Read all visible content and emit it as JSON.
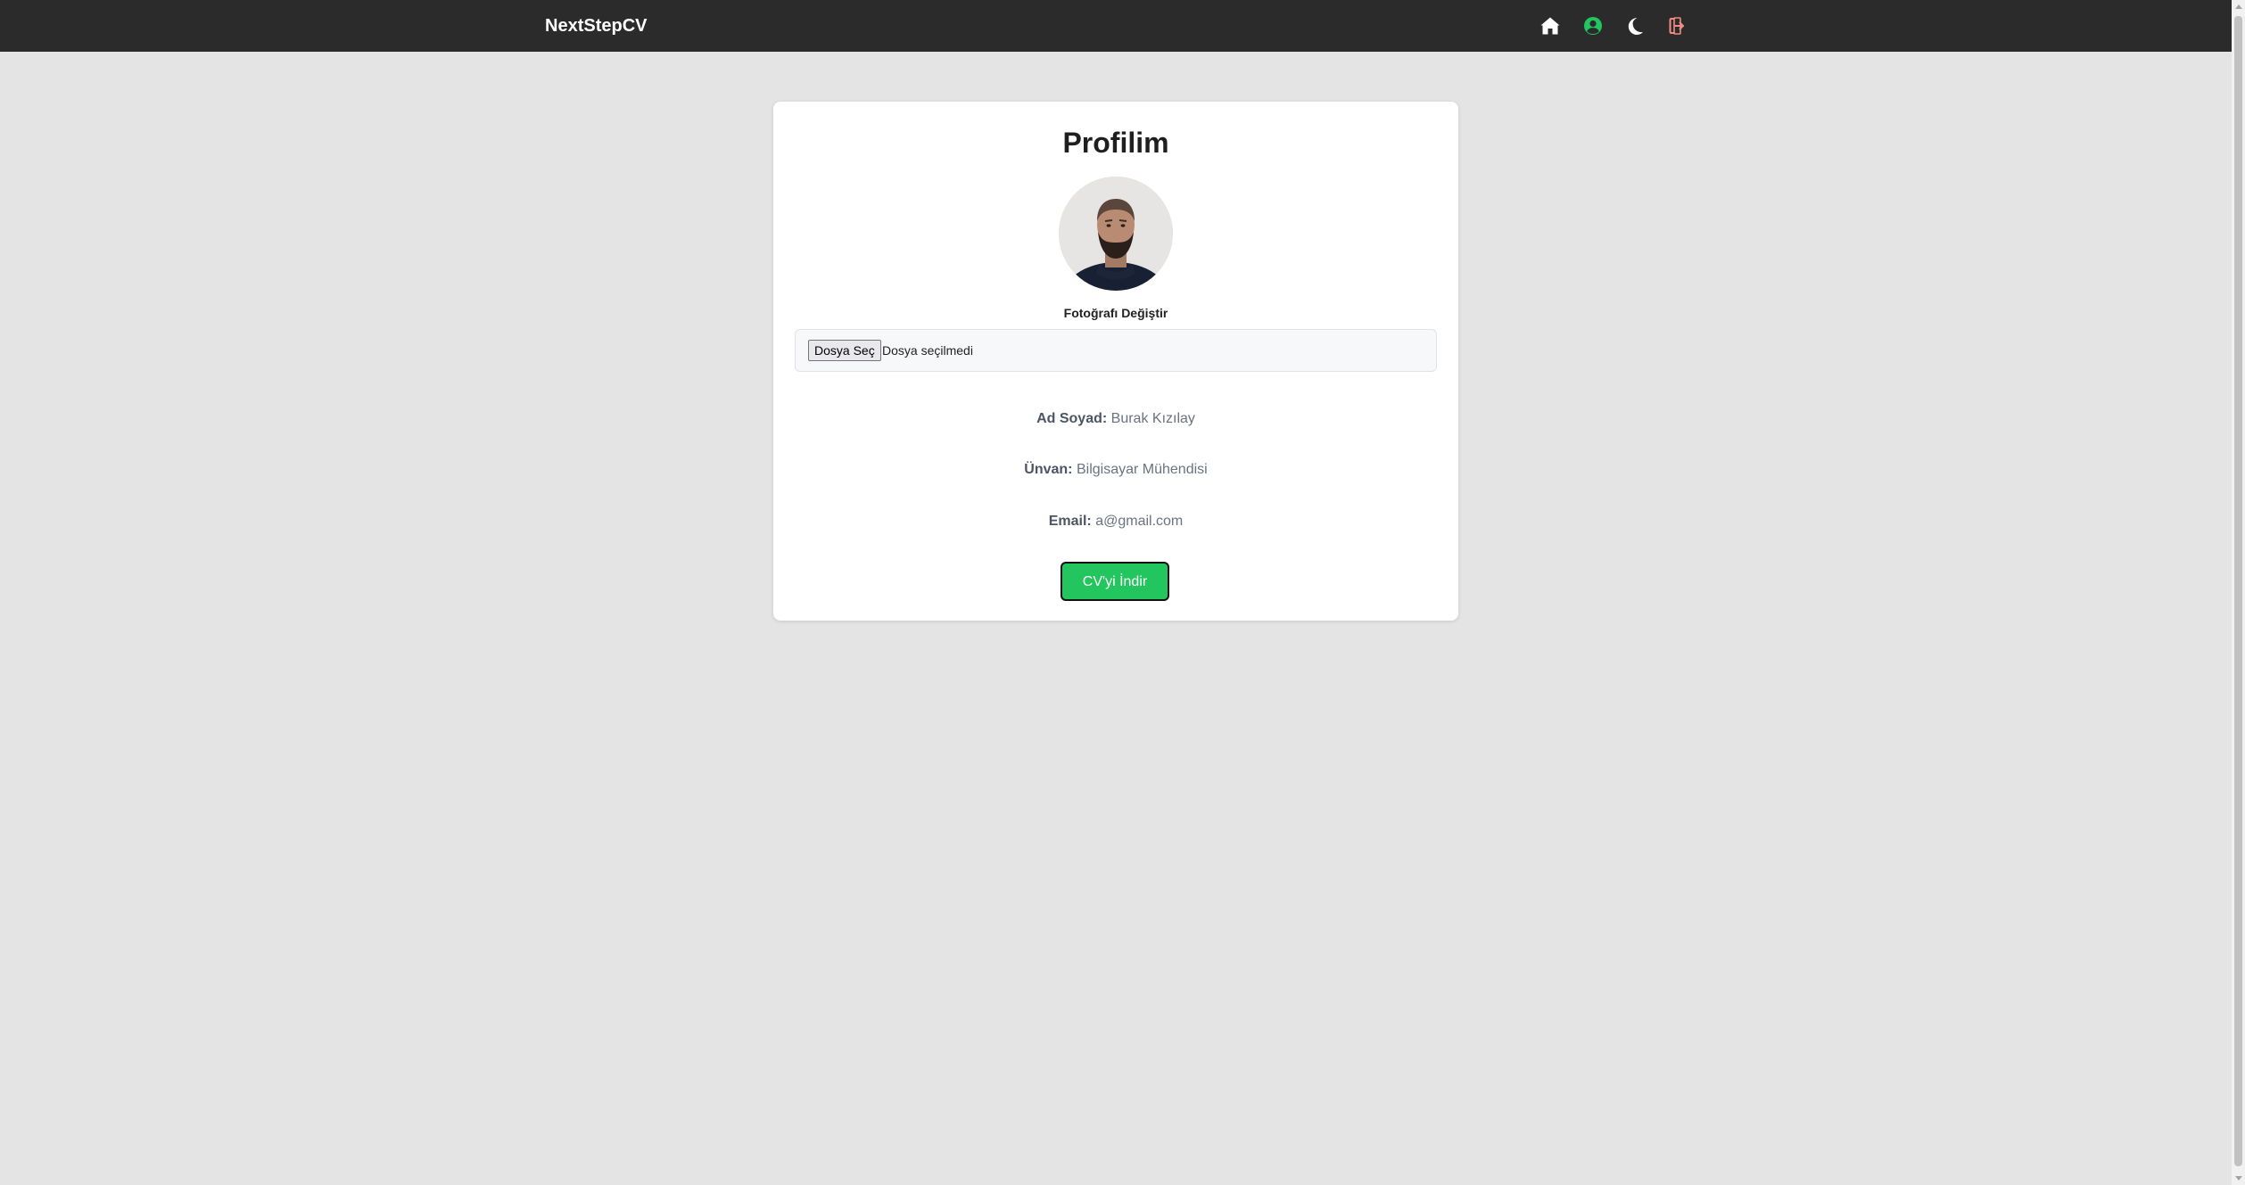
{
  "navbar": {
    "brand": "NextStepCV",
    "icons": {
      "home": "home-icon",
      "profile": "user-circle-icon",
      "theme": "moon-icon",
      "logout": "logout-icon"
    },
    "colors": {
      "background": "#2b2b2b",
      "home_icon": "#ffffff",
      "profile_icon": "#22c55e",
      "theme_icon": "#ffffff",
      "logout_icon": "#f28b82"
    }
  },
  "profile": {
    "title": "Profilim",
    "photo_label": "Fotoğrafı Değiştir",
    "file_input": {
      "button_label": "Dosya Seç",
      "status": "Dosya seçilmedi"
    },
    "fields": [
      {
        "label": "Ad Soyad:",
        "value": "Burak Kızılay"
      },
      {
        "label": "Ünvan:",
        "value": "Bilgisayar Mühendisi"
      },
      {
        "label": "Email:",
        "value": "a@gmail.com"
      }
    ],
    "download_button": "CV'yi İndir"
  },
  "colors": {
    "page_background": "#e4e4e4",
    "card_background": "#ffffff",
    "accent": "#22c55e"
  }
}
